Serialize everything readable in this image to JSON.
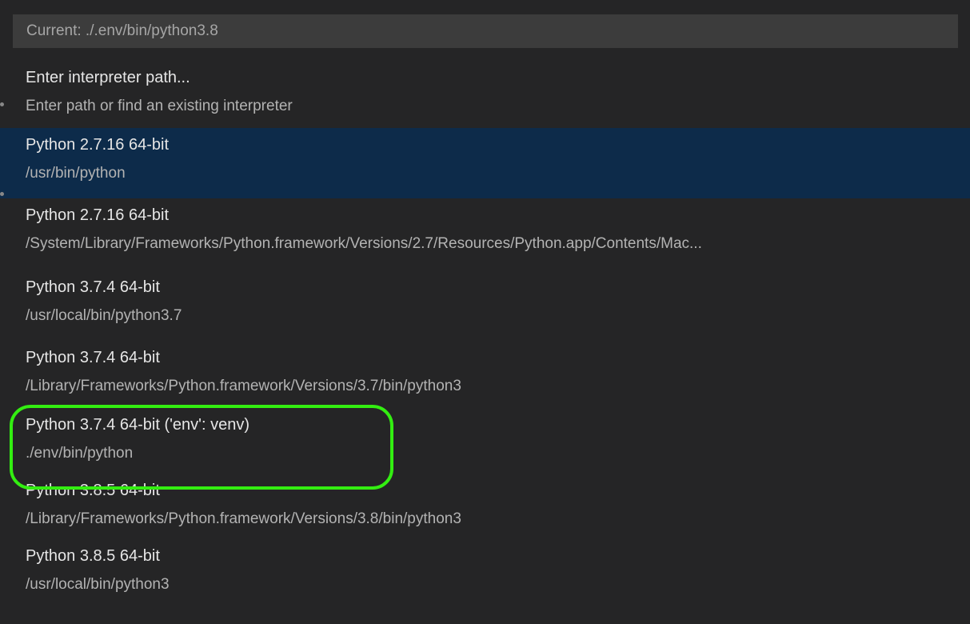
{
  "quick_pick": {
    "input": {
      "value": "",
      "placeholder": "Current: ./.env/bin/python3.8"
    },
    "items": [
      {
        "label": "Enter interpreter path...",
        "description": "Enter path or find an existing interpreter"
      },
      {
        "label": "Python 2.7.16 64-bit",
        "description": "/usr/bin/python",
        "selected": true
      },
      {
        "label": "Python 2.7.16 64-bit",
        "description": "/System/Library/Frameworks/Python.framework/Versions/2.7/Resources/Python.app/Contents/Mac..."
      },
      {
        "label": "Python 3.7.4 64-bit",
        "description": "/usr/local/bin/python3.7"
      },
      {
        "label": "Python 3.7.4 64-bit",
        "description": "/Library/Frameworks/Python.framework/Versions/3.7/bin/python3"
      },
      {
        "label": "Python 3.7.4 64-bit ('env': venv)",
        "description": "./env/bin/python",
        "highlighted": true
      },
      {
        "label": "Python 3.8.5 64-bit",
        "description": "/Library/Frameworks/Python.framework/Versions/3.8/bin/python3"
      },
      {
        "label": "Python 3.8.5 64-bit",
        "description": "/usr/local/bin/python3"
      }
    ]
  },
  "colors": {
    "panel_background": "#252526",
    "input_background": "#3c3c3c",
    "selected_background": "#0d2b4a",
    "highlight_ring": "#33ee11"
  }
}
